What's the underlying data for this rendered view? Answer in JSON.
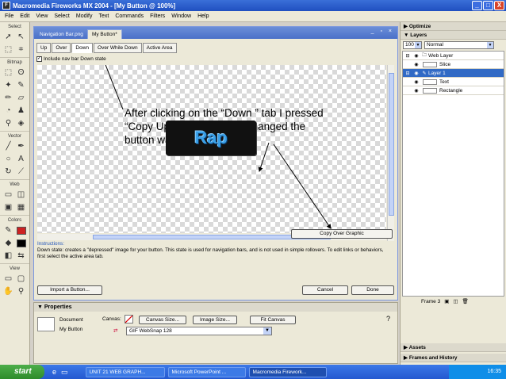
{
  "app": {
    "title": "Macromedia Fireworks MX 2004 - [My Button @ 100%]",
    "window_controls": [
      "_",
      "□",
      "X"
    ]
  },
  "menu": [
    "File",
    "Edit",
    "View",
    "Select",
    "Modify",
    "Text",
    "Commands",
    "Filters",
    "Window",
    "Help"
  ],
  "tools": {
    "sections": [
      "Select",
      "Bitmap",
      "Vector",
      "Web",
      "Colors",
      "View"
    ]
  },
  "document": {
    "tabs": [
      "Navigation Bar.png",
      "My Button*"
    ],
    "doc_controls": "_ ▫ ×",
    "state_tabs": [
      "Up",
      "Over",
      "Down",
      "Over While Down",
      "Active Area"
    ],
    "active_state": "Down",
    "include_nav": "Include nav bar Down state",
    "button_text": "Rap",
    "annotation": "After clicking on the “Down ” tab I pressed “Copy Up Graphic” I then changed the button was shaded",
    "copy_over_label": "Copy Over Graphic",
    "instructions_heading": "Instructions:",
    "instructions_body": "Down state: creates a \"depressed\" image for your button. This state is used for navigation bars, and is not used in simple rollovers. To edit links or behaviors, first select the active area tab.",
    "import_label": "Import a Button...",
    "cancel_label": "Cancel",
    "done_label": "Done"
  },
  "properties": {
    "title": "Properties",
    "doc_label": "Document",
    "doc_name": "My Button",
    "canvas_label": "Canvas:",
    "canvas_size": "Canvas Size...",
    "image_size": "Image Size...",
    "fit_canvas": "Fit Canvas",
    "export_format": "GIF WebSnap 128"
  },
  "right_panel": {
    "optimize": "Optimize",
    "layers": "Layers",
    "opacity": "100",
    "blend": "Normal",
    "layer_rows": [
      {
        "name": "Web Layer",
        "indent": 0
      },
      {
        "name": "Slice",
        "indent": 1
      },
      {
        "name": "Layer 1",
        "indent": 0
      },
      {
        "name": "Text",
        "indent": 1
      },
      {
        "name": "Rectangle",
        "indent": 1
      }
    ],
    "frame": "Frame 3",
    "assets": "Assets",
    "frames_history": "Frames and History"
  },
  "taskbar": {
    "start": "start",
    "tasks": [
      "UNIT 21 WEB GRAPH...",
      "Microsoft PowerPoint ...",
      "Macromedia Firework..."
    ],
    "time": "16:35"
  }
}
